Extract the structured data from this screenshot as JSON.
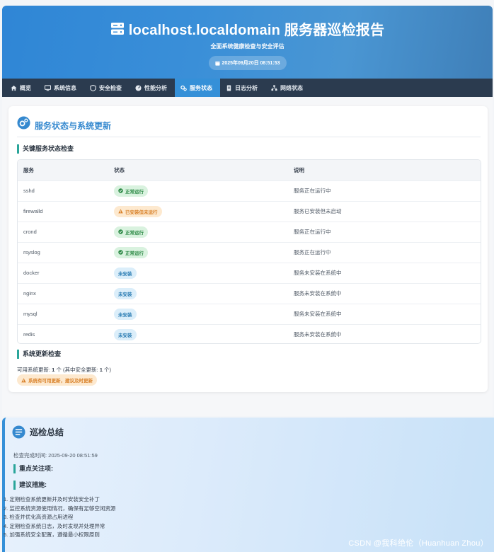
{
  "header": {
    "title": "localhost.localdomain 服务器巡检报告",
    "subtitle": "全面系统健康检查与安全评估",
    "date": "2025年09月20日 08:51:53"
  },
  "nav": {
    "items": [
      {
        "label": "概览",
        "icon": "home-icon"
      },
      {
        "label": "系统信息",
        "icon": "monitor-icon"
      },
      {
        "label": "安全检查",
        "icon": "shield-icon"
      },
      {
        "label": "性能分析",
        "icon": "gauge-icon"
      },
      {
        "label": "服务状态",
        "icon": "cogs-icon",
        "active": true
      },
      {
        "label": "日志分析",
        "icon": "file-icon"
      },
      {
        "label": "网络状态",
        "icon": "network-icon"
      }
    ]
  },
  "services": {
    "title": "服务状态与系统更新",
    "table_heading": "关键服务状态检查",
    "columns": [
      "服务",
      "状态",
      "说明"
    ],
    "rows": [
      {
        "name": "sshd",
        "status": "正常运行",
        "kind": "ok",
        "desc": "服务正在运行中"
      },
      {
        "name": "firewalld",
        "status": "已安装但未运行",
        "kind": "warn",
        "desc": "服务已安装但未启动"
      },
      {
        "name": "crond",
        "status": "正常运行",
        "kind": "ok",
        "desc": "服务正在运行中"
      },
      {
        "name": "rsyslog",
        "status": "正常运行",
        "kind": "ok",
        "desc": "服务正在运行中"
      },
      {
        "name": "docker",
        "status": "未安装",
        "kind": "none",
        "desc": "服务未安装在系统中"
      },
      {
        "name": "nginx",
        "status": "未安装",
        "kind": "none",
        "desc": "服务未安装在系统中"
      },
      {
        "name": "mysql",
        "status": "未安装",
        "kind": "none",
        "desc": "服务未安装在系统中"
      },
      {
        "name": "redis",
        "status": "未安装",
        "kind": "none",
        "desc": "服务未安装在系统中"
      }
    ],
    "updates_heading": "系统更新检查",
    "updates_prefix": "可用系统更新: ",
    "updates_count": "1",
    "updates_mid": " 个 (其中安全更新: ",
    "security_count": "1",
    "updates_suffix": " 个)",
    "updates_badge": "系统有可用更新，建议及时更新"
  },
  "summary": {
    "title": "巡检总结",
    "time": "检查完成时间: 2025-09-20 08:51:59",
    "focus_heading": "重点关注项:",
    "advice_heading": "建议措施:",
    "steps": [
      "1. 定期检查系统更新并及时安装安全补丁",
      "2. 监控系统资源使用情况，确保有足够空闲资源",
      "3. 检查并优化高资源占用进程",
      "4. 定期检查系统日志，及时发现并处理异常",
      "5. 加强系统安全配置，遵循最小权限原则"
    ]
  },
  "watermark": "CSDN @我科绝伦（Huanhuan Zhou）",
  "colors": {
    "accent": "#3590d8",
    "nav_bg": "#2b3b4f",
    "ok": "#2e8b47",
    "warn": "#d9822b",
    "none": "#2f7fb5",
    "teal": "#2aa59a"
  }
}
